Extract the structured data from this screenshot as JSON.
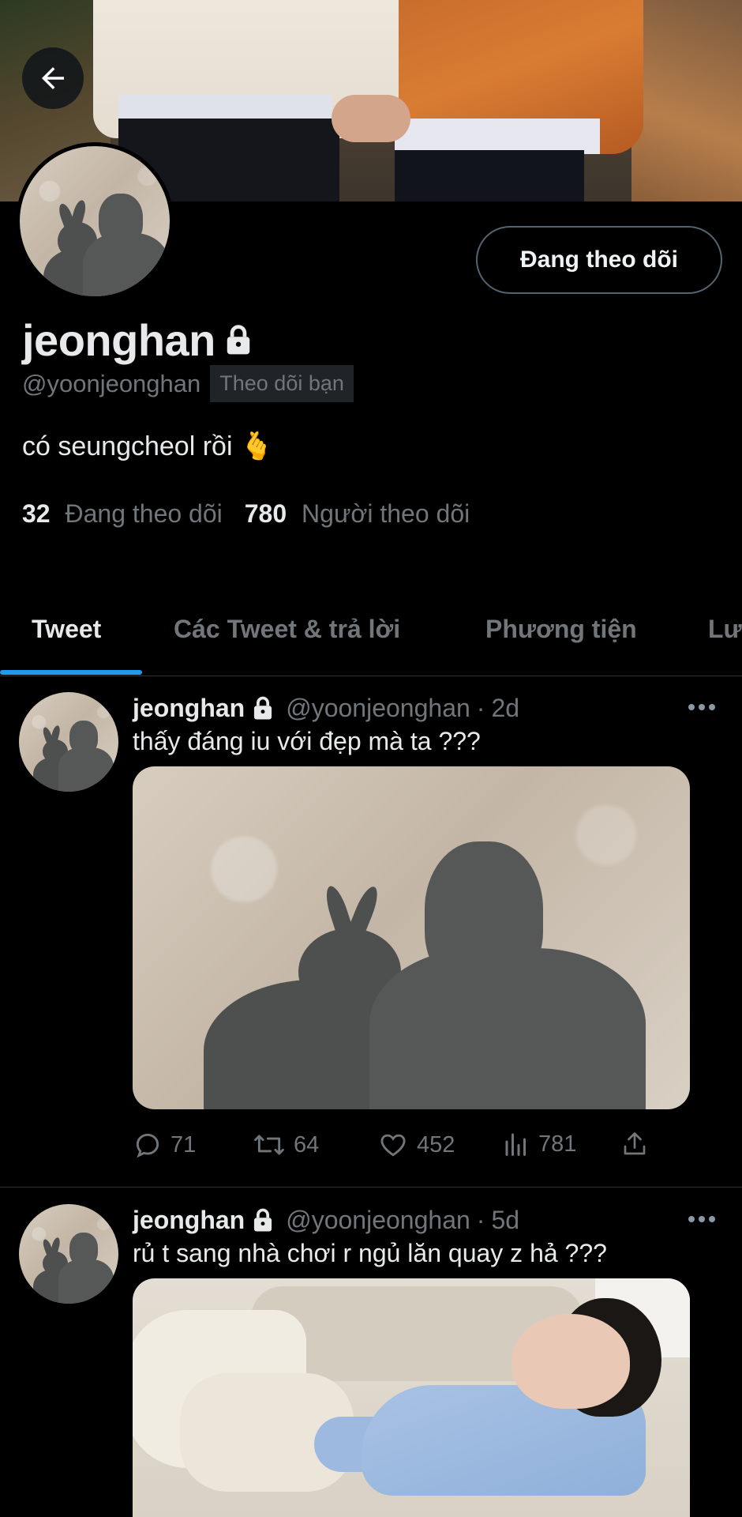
{
  "profile": {
    "name": "jeonghan",
    "handle": "@yoonjeonghan",
    "follows_you_label": "Theo dõi bạn",
    "bio_text": "có seungcheol rồi",
    "bio_emoji": "🫰",
    "following_count": "32",
    "following_label": "Đang theo dõi",
    "followers_count": "780",
    "followers_label": "Người theo dõi",
    "follow_button_label": "Đang theo dõi"
  },
  "tabs": [
    {
      "label": "Tweet",
      "active": true
    },
    {
      "label": "Các Tweet & trả lời",
      "active": false
    },
    {
      "label": "Phương tiện",
      "active": false
    },
    {
      "label": "Lư",
      "active": false
    }
  ],
  "tweets": [
    {
      "name": "jeonghan",
      "handle": "@yoonjeonghan",
      "sep": "·",
      "time": "2d",
      "text": "thấy đáng iu với đẹp mà ta ???",
      "replies": "71",
      "retweets": "64",
      "likes": "452",
      "views": "781"
    },
    {
      "name": "jeonghan",
      "handle": "@yoonjeonghan",
      "sep": "·",
      "time": "5d",
      "text": "rủ t sang nhà chơi r ngủ lăn quay z hả ???"
    }
  ],
  "colors": {
    "background": "#000000",
    "text_primary": "#e7e9ea",
    "text_secondary": "#71767b",
    "accent": "#1d9bf0",
    "border": "#2f3336"
  },
  "icons": {
    "back": "arrow-left-icon",
    "lock": "lock-icon",
    "more": "more-horizontal-icon",
    "reply": "reply-icon",
    "retweet": "retweet-icon",
    "like": "heart-icon",
    "views": "views-icon",
    "share": "share-icon"
  }
}
